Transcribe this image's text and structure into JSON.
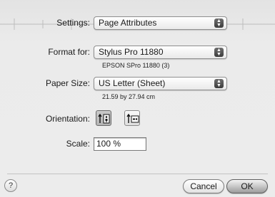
{
  "settings": {
    "label": "Settings:",
    "value": "Page Attributes"
  },
  "format_for": {
    "label": "Format for:",
    "value": "Stylus Pro 11880",
    "detail": "EPSON SPro 11880 (3)"
  },
  "paper_size": {
    "label": "Paper Size:",
    "value": "US Letter (Sheet)",
    "detail": "21.59 by 27.94 cm"
  },
  "orientation": {
    "label": "Orientation:",
    "selected": "portrait"
  },
  "scale": {
    "label": "Scale:",
    "value": "100 %"
  },
  "footer": {
    "help_label": "?",
    "cancel_label": "Cancel",
    "ok_label": "OK"
  },
  "icons": {
    "popup_arrows": "up-down-arrows-icon",
    "help": "question-mark-icon"
  },
  "colors": {
    "sheet_bg": "#ececec",
    "default_button": "#9c9c9c"
  }
}
